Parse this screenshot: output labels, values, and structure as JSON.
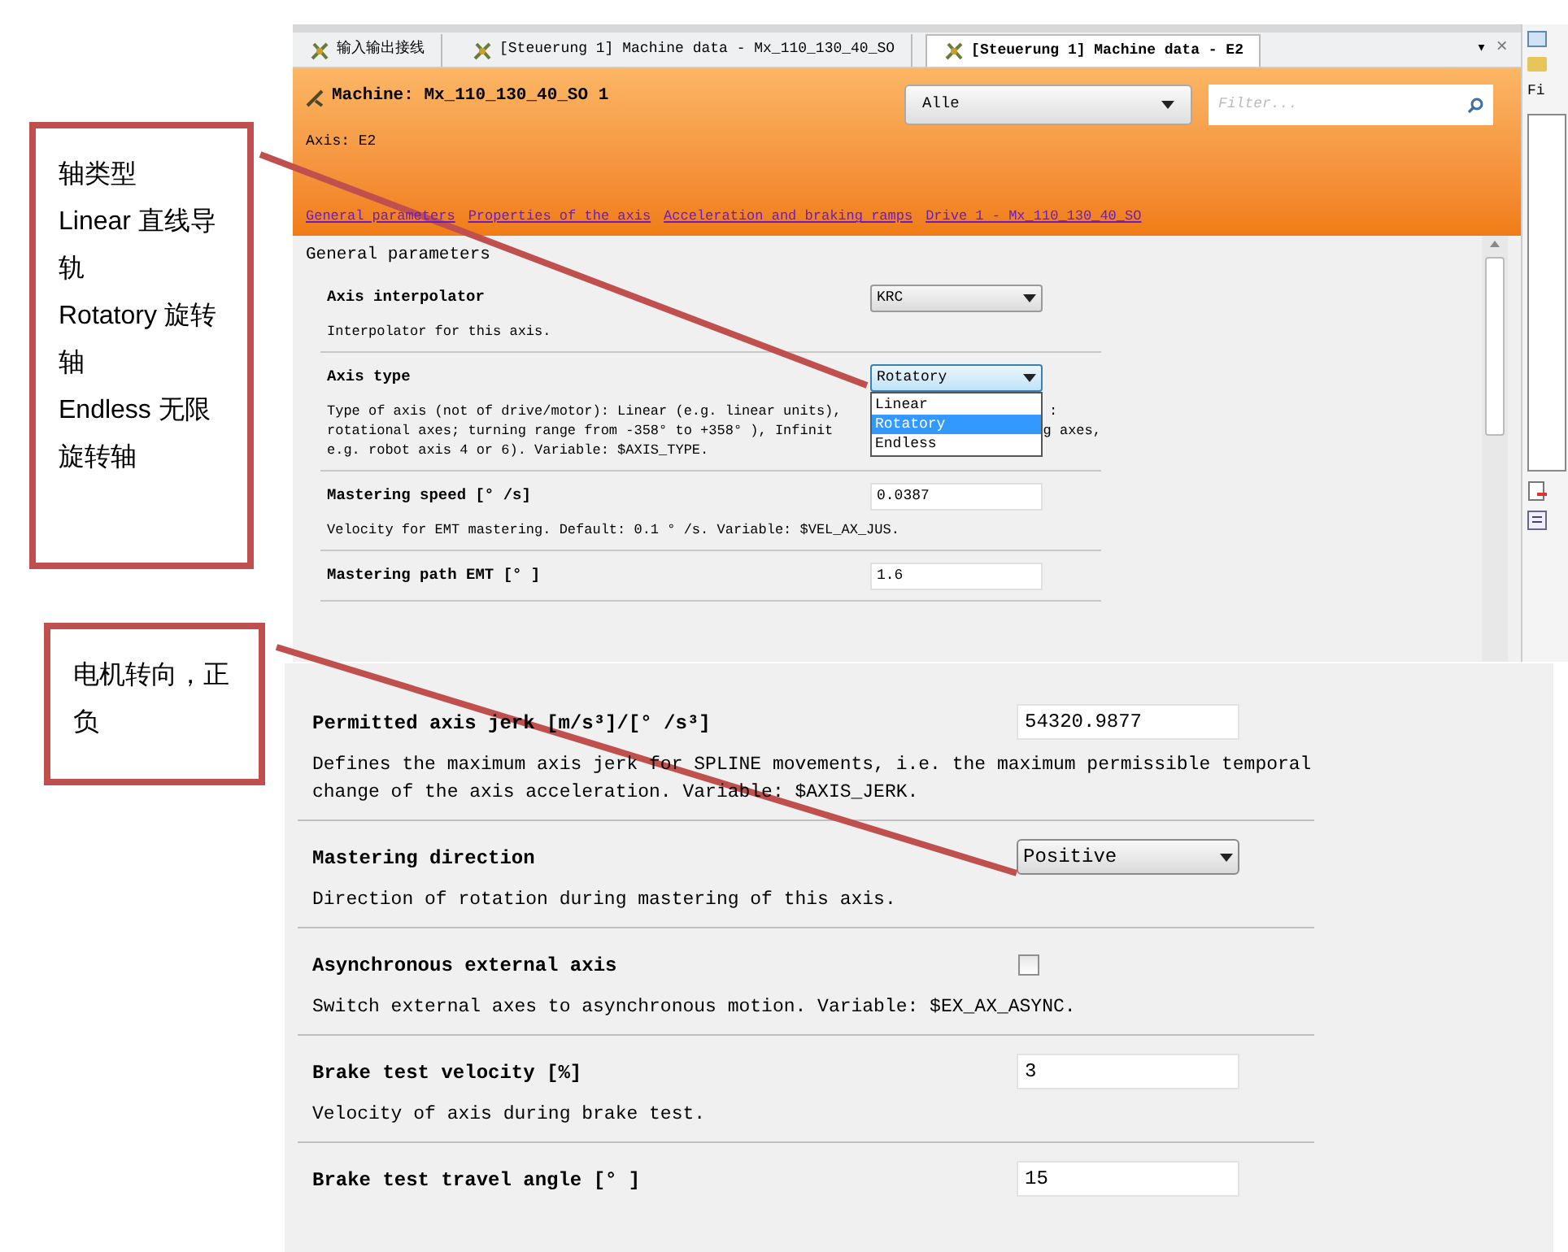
{
  "annotations": [
    {
      "lines": [
        "轴类型",
        "Linear 直线导轨",
        "Rotatory 旋转轴",
        "Endless 无限旋转轴"
      ]
    },
    {
      "lines": [
        "电机转向，正负"
      ]
    }
  ],
  "upper_screenshot": {
    "tabs": [
      {
        "label": "输入输出接线",
        "selected": false
      },
      {
        "label": "[Steuerung 1] Machine data - Mx_110_130_40_SO",
        "selected": false
      },
      {
        "label": "[Steuerung 1] Machine data - E2",
        "selected": true
      }
    ],
    "tab_menu": "▾",
    "tab_close": "×",
    "header": {
      "title": "Machine: Mx_110_130_40_SO 1",
      "filter_select": "Alle",
      "filter_placeholder": "Filter...",
      "axis": "Axis: E2",
      "links": [
        "General parameters",
        "Properties of the axis",
        "Acceleration and braking ramps",
        "Drive 1 - Mx_110_130_40_SO"
      ]
    },
    "section_title": "General parameters",
    "params": [
      {
        "kind": "select",
        "label": "Axis interpolator",
        "value": "KRC",
        "description": [
          {
            "text": "Interpolator for this axis."
          }
        ]
      },
      {
        "kind": "select",
        "label": "Axis type",
        "value": "Rotatory",
        "expanded": true,
        "options": [
          {
            "label": "Linear",
            "selected": false
          },
          {
            "label": "Rotatory",
            "selected": true
          },
          {
            "label": "Endless",
            "selected": false
          }
        ],
        "description": [
          {
            "text": "Type of axis (not of drive/motor): Linear (e.g. linear units),",
            "tail": ":"
          },
          {
            "text": "rotational axes; turning range from -358°  to +358° ), Infinit",
            "tail": "g axes,"
          },
          {
            "text": "e.g. robot axis 4 or 6). Variable: $AXIS_TYPE."
          }
        ]
      },
      {
        "kind": "input",
        "label": "Mastering speed [° /s]",
        "value": "0.0387",
        "description": [
          {
            "text": "Velocity for EMT mastering. Default: 0.1 ° /s. Variable: $VEL_AX_JUS."
          }
        ]
      },
      {
        "kind": "input",
        "label": "Mastering path EMT [° ]",
        "value": "1.6"
      }
    ],
    "side_panel_label": "Fi"
  },
  "lower_screenshot": {
    "params": [
      {
        "kind": "input",
        "label": "Permitted axis jerk [m/s³]/[° /s³]",
        "value": "54320.9877",
        "description": [
          "Defines the maximum axis jerk for SPLINE movements, i.e. the maximum permissible temporal",
          "change of the axis acceleration. Variable: $AXIS_JERK."
        ]
      },
      {
        "kind": "select",
        "label": "Mastering direction",
        "value": "Positive",
        "description": [
          "Direction of rotation during mastering of this axis."
        ]
      },
      {
        "kind": "checkbox",
        "label": "Asynchronous external axis",
        "checked": false,
        "description": [
          "Switch external axes to asynchronous motion. Variable: $EX_AX_ASYNC."
        ]
      },
      {
        "kind": "input",
        "label": "Brake test velocity [%]",
        "value": "3",
        "description": [
          "Velocity of axis during brake test."
        ]
      },
      {
        "kind": "input",
        "label": "Brake test travel angle [° ]",
        "value": "15"
      }
    ]
  }
}
